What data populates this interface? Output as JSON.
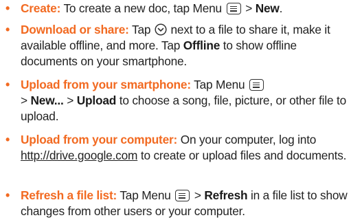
{
  "items": [
    {
      "heading": "Create:",
      "t1": "To create a new doc, tap Menu",
      "t2": ">",
      "b1": "New",
      "t3": "."
    },
    {
      "heading": "Download or share:",
      "t1": "Tap",
      "t2": "next to a file to share it, make it available offline, and more. Tap",
      "b1": "Offline",
      "t3": "to show offline documents on your smartphone."
    },
    {
      "heading": "Upload from your smartphone:",
      "t1": "Tap Menu",
      "t2": ">",
      "b1": "New...",
      "t3": ">",
      "b2": "Upload",
      "t4": "to choose a song, file, picture, or other file to upload."
    },
    {
      "heading": "Upload from your computer:",
      "t1": "On your computer, log into",
      "link": "http://drive.google.com",
      "t2": "to create or upload files and documents."
    },
    {
      "heading": "Refresh a file list:",
      "t1": "Tap Menu",
      "t2": ">",
      "b1": "Refresh",
      "t3": "in a file list to show changes from other users or your computer."
    }
  ],
  "colors": {
    "heading": "#f26a21",
    "text": "#222222"
  },
  "icons": {
    "menu": "menu-icon",
    "options": "chevron-down-circle-icon"
  },
  "bullet_char": "•"
}
